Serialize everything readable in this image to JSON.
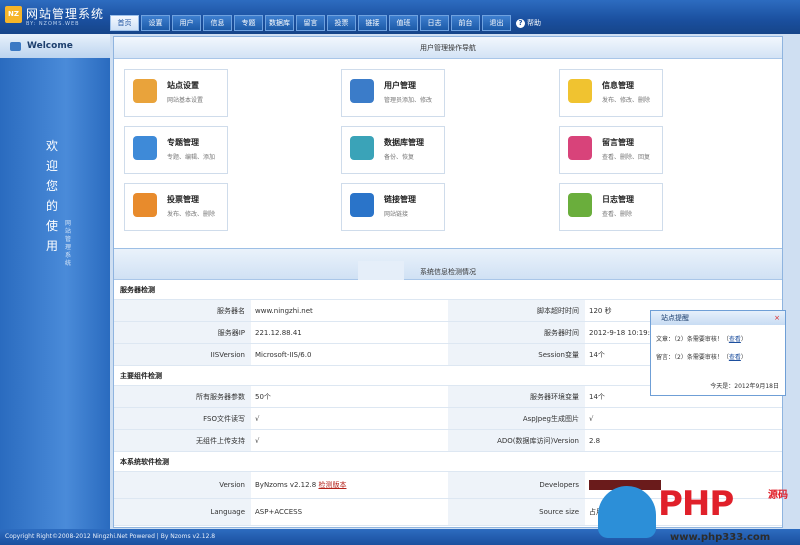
{
  "app": {
    "title": "网站管理系统",
    "subtitle": "BY: NZOMS.WEB",
    "logo_text": "NZ"
  },
  "nav": {
    "items": [
      "首页",
      "设置",
      "用户",
      "信息",
      "专题",
      "数据库",
      "留言",
      "投票",
      "链接",
      "值班",
      "日志",
      "前台",
      "退出"
    ],
    "active_index": 0,
    "help_label": "帮助"
  },
  "sidebar": {
    "welcome": "Welcome",
    "vertical_text": "欢迎您的使用",
    "vertical_small": "网站管理系统"
  },
  "nav_panel": {
    "title": "用户管理操作导航",
    "cards": [
      {
        "title": "站点设置",
        "desc": "网站基本设置",
        "icon": "house-icon",
        "color": "#e9a33b"
      },
      {
        "title": "用户管理",
        "desc": "管理员添加、修改",
        "icon": "user-icon",
        "color": "#3b7cc9"
      },
      {
        "title": "信息管理",
        "desc": "发布、修改、删除",
        "icon": "notepad-icon",
        "color": "#f0c330"
      },
      {
        "title": "专题管理",
        "desc": "专题、编辑、添加",
        "icon": "book-icon",
        "color": "#3e8ad8"
      },
      {
        "title": "数据库管理",
        "desc": "备份、恢复",
        "icon": "cd-icon",
        "color": "#3aa3b8"
      },
      {
        "title": "留言管理",
        "desc": "查看、删除、回复",
        "icon": "message-icon",
        "color": "#d8437a"
      },
      {
        "title": "投票管理",
        "desc": "发布、修改、删除",
        "icon": "bar-chart-icon",
        "color": "#e88b2c"
      },
      {
        "title": "链接管理",
        "desc": "网站链接",
        "icon": "ie-icon",
        "color": "#2a74c9"
      },
      {
        "title": "日志管理",
        "desc": "查看、删除",
        "icon": "check-doc-icon",
        "color": "#6aae3c"
      }
    ]
  },
  "system_panel": {
    "title": "系统信息检测情况"
  },
  "server": {
    "group": "服务器检测",
    "rows": [
      {
        "l1": "服务器名",
        "v1": "www.ningzhi.net",
        "l2": "脚本超时时间",
        "v2": "120 秒"
      },
      {
        "l1": "服务器IP",
        "v1": "221.12.88.41",
        "l2": "服务器时间",
        "v2": "2012-9-18 10:19:25"
      },
      {
        "l1": "IISVersion",
        "v1": "Microsoft-IIS/6.0",
        "l2": "Session变量",
        "v2": "14个"
      }
    ]
  },
  "components": {
    "group": "主要组件检测",
    "rows": [
      {
        "l1": "所有服务器参数",
        "v1": "50个",
        "l2": "服务器环境变量",
        "v2": "14个"
      },
      {
        "l1": "FSO文件读写",
        "v1": "√",
        "l2": "AspJpeg生成图片",
        "v2": "√"
      },
      {
        "l1": "无组件上传支持",
        "v1": "√",
        "l2": "ADO(数据库访问)Version",
        "v2": "2.8"
      }
    ]
  },
  "software": {
    "group": "本系统软件检测",
    "version_label": "Version",
    "version_value": "ByNzoms v2.12.8",
    "version_link": "检测版本",
    "developers_label": "Developers",
    "language_label": "Language",
    "language_value": "ASP+ACCESS",
    "source_label": "Source size",
    "source_value": "占用空间"
  },
  "popup": {
    "title": "站点提醒",
    "close": "×",
    "line1_prefix": "文章：（",
    "line1_count": "2",
    "line1_suffix": "）条需要审核！（",
    "line1_link": "查看",
    "line1_end": "）",
    "line2_prefix": "留言：（",
    "line2_count": "2",
    "line2_suffix": "）条需要审核！（",
    "line2_link": "查看",
    "line2_end": "）",
    "date": "今天是：2012年9月18日"
  },
  "footer": {
    "text": "Copyright Right©2008-2012 Ningzhi.Net Powered | By Nzoms v2.12.8"
  },
  "watermark": {
    "php": "PHP",
    "src": "源码",
    "url": "www.php333.com"
  }
}
